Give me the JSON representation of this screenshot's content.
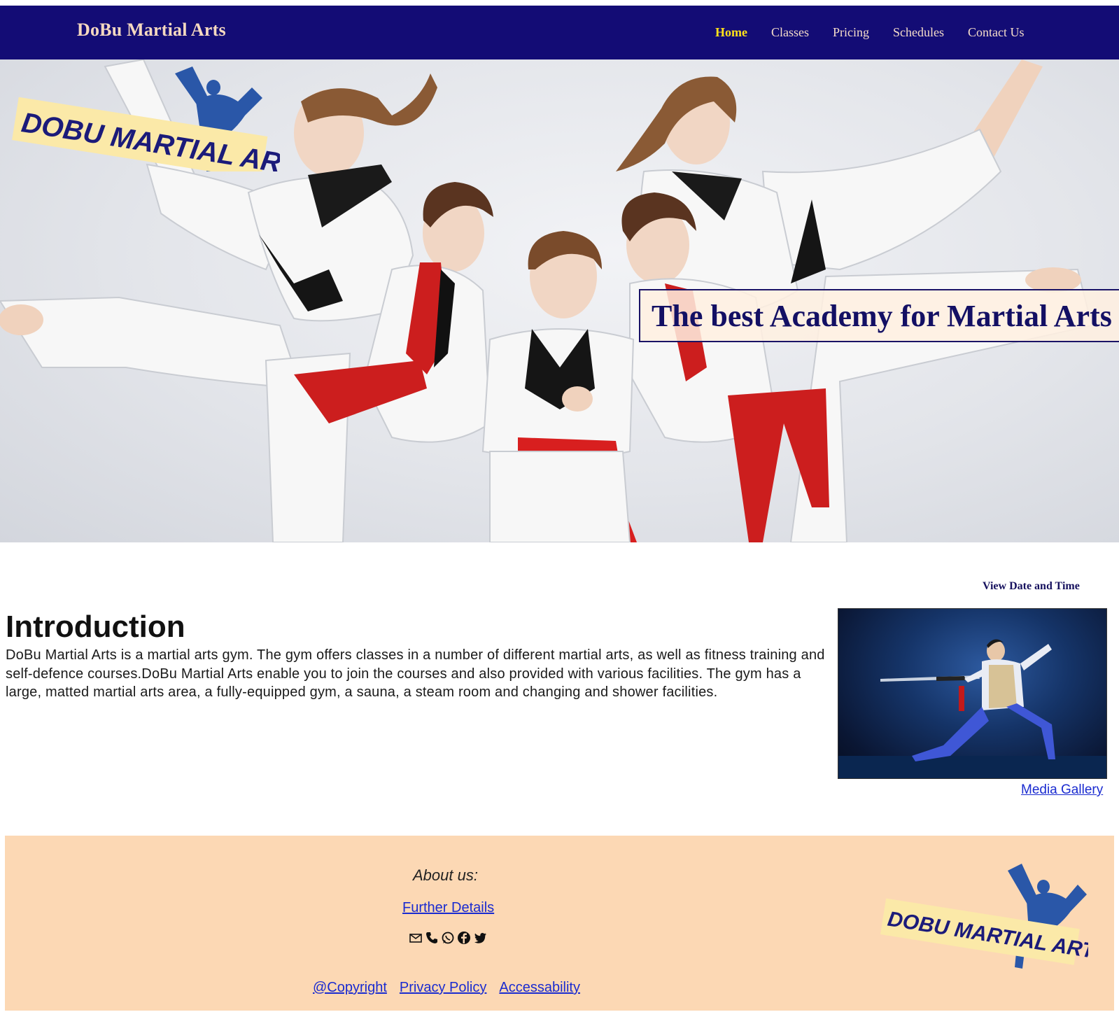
{
  "header": {
    "brand": "DoBu Martial Arts",
    "nav": [
      {
        "label": "Home",
        "active": true
      },
      {
        "label": "Classes",
        "active": false
      },
      {
        "label": "Pricing",
        "active": false
      },
      {
        "label": "Schedules",
        "active": false
      },
      {
        "label": "Contact Us",
        "active": false
      }
    ]
  },
  "hero": {
    "banner": "The best Academy for Martial Arts",
    "logo_text": "DOBU MARTIAL ARTS"
  },
  "main": {
    "view_date_time": "View Date and Time",
    "intro_title": "Introduction",
    "intro_text": "DoBu Martial Arts is a martial arts gym. The gym offers classes in a number of different martial arts, as well as fitness training and self-defence courses.DoBu Martial Arts enable you to join the courses and also provided with various facilities. The gym has a large, matted martial arts area, a fully-equipped gym, a sauna, a steam room and changing and shower facilities.",
    "media_gallery": "Media Gallery"
  },
  "footer": {
    "about": "About us:",
    "further_details": "Further Details",
    "social_icons": [
      "mail-icon",
      "phone-icon",
      "whatsapp-icon",
      "facebook-icon",
      "twitter-icon"
    ],
    "legal": [
      "@Copyright",
      "Privacy Policy",
      "Accessability"
    ],
    "logo_text": "DOBU MARTIAL ARTS"
  },
  "colors": {
    "nav_bg": "#130c75",
    "nav_active": "#ffe21a",
    "footer_bg": "#fcd8b4",
    "link": "#1a2bd0"
  }
}
